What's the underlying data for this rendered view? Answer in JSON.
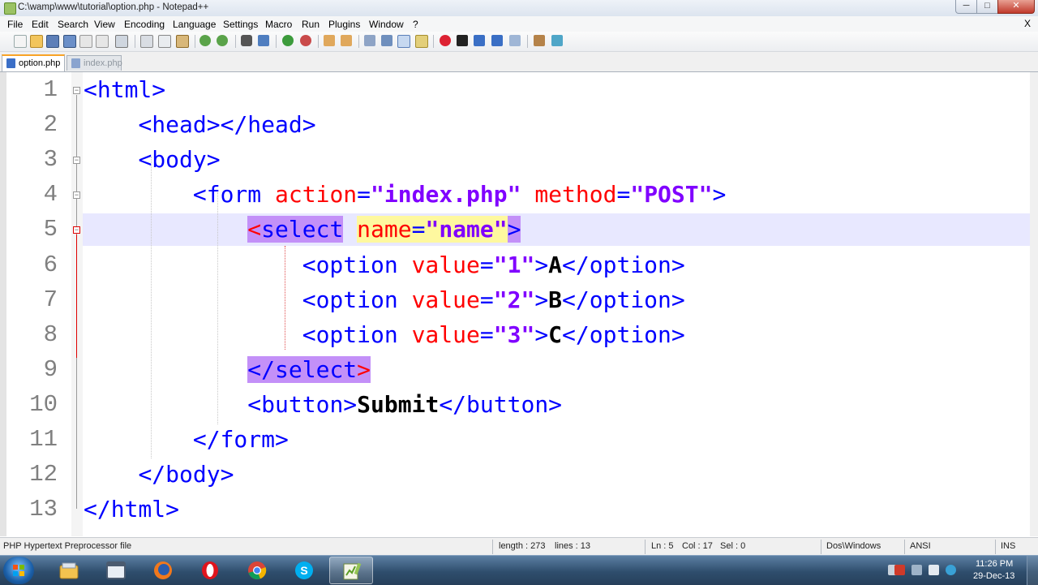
{
  "window": {
    "title": "C:\\wamp\\www\\tutorial\\option.php - Notepad++",
    "min_glyph": "─",
    "max_glyph": "□",
    "close_glyph": "✕"
  },
  "menu": {
    "items": [
      "File",
      "Edit",
      "Search",
      "View",
      "Encoding",
      "Language",
      "Settings",
      "Macro",
      "Run",
      "Plugins",
      "Window",
      "?"
    ],
    "close": "X"
  },
  "tabs": [
    {
      "label": "option.php",
      "active": true
    },
    {
      "label": "index.php",
      "active": false
    }
  ],
  "editor": {
    "current_line": 5,
    "lines": [
      {
        "num": "1",
        "indent": "",
        "segments": [
          {
            "t": "<html>",
            "c": "tag"
          }
        ]
      },
      {
        "num": "2",
        "indent": "    ",
        "segments": [
          {
            "t": "<head></head>",
            "c": "tag"
          }
        ]
      },
      {
        "num": "3",
        "indent": "    ",
        "segments": [
          {
            "t": "<body>",
            "c": "tag"
          }
        ]
      },
      {
        "num": "4",
        "indent": "        ",
        "segments": [
          {
            "t": "<form ",
            "c": "tag"
          },
          {
            "t": "action",
            "c": "attr"
          },
          {
            "t": "=",
            "c": "tag"
          },
          {
            "t": "\"index.php\"",
            "c": "val"
          },
          {
            "t": " ",
            "c": "tag"
          },
          {
            "t": "method",
            "c": "attr"
          },
          {
            "t": "=",
            "c": "tag"
          },
          {
            "t": "\"POST\"",
            "c": "val"
          },
          {
            "t": ">",
            "c": "tag"
          }
        ]
      },
      {
        "num": "5",
        "indent": "            ",
        "segments": [
          {
            "t": "<",
            "c": "tag hl-tag red-b"
          },
          {
            "t": "select",
            "c": "tag hl-tag"
          },
          {
            "t": " ",
            "c": "tag"
          },
          {
            "t": "name",
            "c": "attr hl-attr"
          },
          {
            "t": "=",
            "c": "tag hl-attr"
          },
          {
            "t": "\"name\"",
            "c": "val hl-attr"
          },
          {
            "t": ">",
            "c": "tag hl-tag"
          }
        ]
      },
      {
        "num": "6",
        "indent": "                ",
        "segments": [
          {
            "t": "<option ",
            "c": "tag"
          },
          {
            "t": "value",
            "c": "attr"
          },
          {
            "t": "=",
            "c": "tag"
          },
          {
            "t": "\"1\"",
            "c": "val"
          },
          {
            "t": ">",
            "c": "tag"
          },
          {
            "t": "A",
            "c": "txt"
          },
          {
            "t": "</option>",
            "c": "tag"
          }
        ]
      },
      {
        "num": "7",
        "indent": "                ",
        "segments": [
          {
            "t": "<option ",
            "c": "tag"
          },
          {
            "t": "value",
            "c": "attr"
          },
          {
            "t": "=",
            "c": "tag"
          },
          {
            "t": "\"2\"",
            "c": "val"
          },
          {
            "t": ">",
            "c": "tag"
          },
          {
            "t": "B",
            "c": "txt"
          },
          {
            "t": "</option>",
            "c": "tag"
          }
        ]
      },
      {
        "num": "8",
        "indent": "                ",
        "segments": [
          {
            "t": "<option ",
            "c": "tag"
          },
          {
            "t": "value",
            "c": "attr"
          },
          {
            "t": "=",
            "c": "tag"
          },
          {
            "t": "\"3\"",
            "c": "val"
          },
          {
            "t": ">",
            "c": "tag"
          },
          {
            "t": "C",
            "c": "txt"
          },
          {
            "t": "</option>",
            "c": "tag"
          }
        ]
      },
      {
        "num": "9",
        "indent": "            ",
        "segments": [
          {
            "t": "</select",
            "c": "tag hl-tag"
          },
          {
            "t": ">",
            "c": "tag hl-tag red-b"
          }
        ]
      },
      {
        "num": "10",
        "indent": "            ",
        "segments": [
          {
            "t": "<button>",
            "c": "tag"
          },
          {
            "t": "Submit",
            "c": "txt"
          },
          {
            "t": "</button>",
            "c": "tag"
          }
        ]
      },
      {
        "num": "11",
        "indent": "        ",
        "segments": [
          {
            "t": "</form>",
            "c": "tag"
          }
        ]
      },
      {
        "num": "12",
        "indent": "    ",
        "segments": [
          {
            "t": "</body>",
            "c": "tag"
          }
        ]
      },
      {
        "num": "13",
        "indent": "",
        "segments": [
          {
            "t": "</html>",
            "c": "tag"
          }
        ]
      }
    ],
    "fold_lines": [
      "1",
      "3",
      "4",
      "5"
    ]
  },
  "status": {
    "file_type": "PHP Hypertext Preprocessor file",
    "length": "length : 273",
    "lines": "lines : 13",
    "ln": "Ln : 5",
    "col": "Col : 17",
    "sel": "Sel : 0",
    "eol": "Dos\\Windows",
    "encoding": "ANSI",
    "mode": "INS"
  },
  "taskbar": {
    "apps": [
      "explorer-icon",
      "window-icon",
      "firefox-icon",
      "opera-icon",
      "chrome-icon",
      "skype-icon",
      "notepadpp-icon"
    ],
    "active_app": "notepadpp-icon",
    "clock_time": "11:26 PM",
    "clock_date": "29-Dec-13"
  },
  "colors": {
    "tag": "#0000ff",
    "attr": "#ff0000",
    "value": "#8000ff",
    "tag_highlight": "#c390f8",
    "attr_highlight": "#fef89f",
    "current_line": "#e8e8ff"
  }
}
